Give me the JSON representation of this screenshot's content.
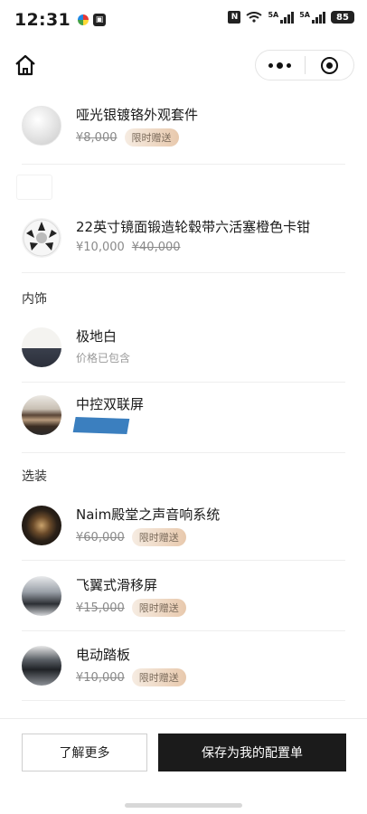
{
  "status_bar": {
    "time": "12:31",
    "left_icons": [
      "flower-app-icon",
      "nfc-notification-icon"
    ],
    "nfc_label": "N",
    "signal_1_label": "5A",
    "signal_2_label": "5A",
    "battery": "85"
  },
  "nav": {
    "home_icon": "home-icon",
    "more_icon": "more-dots-icon",
    "close_icon": "target-close-icon"
  },
  "items": [
    {
      "title": "哑光银镀铬外观套件",
      "price": "¥8,000",
      "badge": "限时赠送"
    },
    {
      "title": "22英寸镜面锻造轮毂带六活塞橙色卡钳",
      "price": "¥10,000",
      "original_price": "¥40,000"
    },
    {
      "title": "极地白",
      "note": "价格已包含"
    },
    {
      "title": "中控双联屏"
    },
    {
      "title": "Naim殿堂之声音响系统",
      "price": "¥60,000",
      "badge": "限时赠送"
    },
    {
      "title": "飞翼式滑移屏",
      "price": "¥15,000",
      "badge": "限时赠送"
    },
    {
      "title": "电动踏板",
      "price": "¥10,000",
      "badge": "限时赠送"
    }
  ],
  "sections": {
    "interior": "内饰",
    "options": "选装"
  },
  "bottom": {
    "learn_more": "了解更多",
    "save_config": "保存为我的配置单"
  }
}
